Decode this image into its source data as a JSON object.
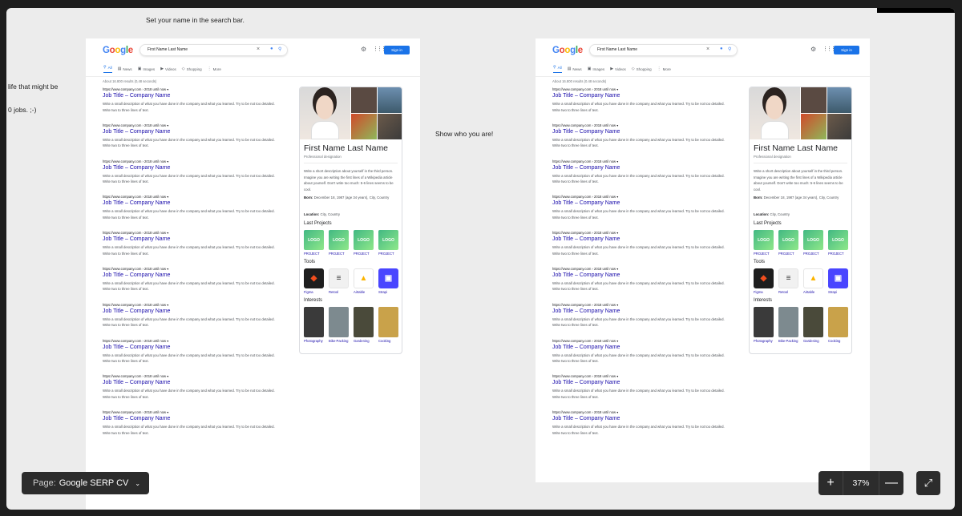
{
  "canvas": {
    "notes": {
      "top": "Set your name in the search bar.",
      "left_1": "life that might be",
      "left_2": "0 jobs. ;-)",
      "middle": "Show who you are!"
    }
  },
  "serp": {
    "logo_letters": [
      "G",
      "o",
      "o",
      "g",
      "l",
      "e"
    ],
    "search_query": "First Name Last Name",
    "signin_label": "Sign in",
    "tabs": [
      {
        "label": "All",
        "icon": "search-icon"
      },
      {
        "label": "News",
        "icon": "news-icon"
      },
      {
        "label": "Images",
        "icon": "image-icon"
      },
      {
        "label": "Videos",
        "icon": "video-icon"
      },
      {
        "label": "Shopping",
        "icon": "tag-icon"
      },
      {
        "label": "More",
        "icon": "more-icon"
      }
    ],
    "stats_left": "About 16.800 results (0,48 seconds)",
    "stats_right": "About 16.800 results (0.48 seconds)",
    "result_url": "https://www.company.com › 2018 until now ▾",
    "result_title": "Job Title – Company Name",
    "result_desc": "Write a small description of what you have done in the company and what you learned. Try to be not too detailed. Write two to three lines of text.",
    "result_count": 10
  },
  "panel": {
    "name": "First Name Last Name",
    "subtitle": "Professional designation",
    "description": "Write a short description about yourself in the third person. Imagine you are writing the first lines of a Wikipedia article about yourself. Don't write too much: 5-6 lines seems to be cool.",
    "born_label": "Born:",
    "born_value": "December 18, 1987 (age 34 years), City, Country",
    "location_label": "Location:",
    "location_value": "City, Country",
    "projects_title": "Last Projects",
    "projects": [
      {
        "logo": "LOGO",
        "caption": "PROJECT"
      },
      {
        "logo": "LOGO",
        "caption": "PROJECT"
      },
      {
        "logo": "LOGO",
        "caption": "PROJECT"
      },
      {
        "logo": "LOGO",
        "caption": "PROJECT"
      }
    ],
    "tools_title": "Tools",
    "tools": [
      {
        "name": "Figma",
        "bg": "#1e1e1e"
      },
      {
        "name": "Retool",
        "bg": "#f1f1f1"
      },
      {
        "name": "Airtable",
        "bg": "#ffffff"
      },
      {
        "name": "Strapi",
        "bg": "#4945ff"
      }
    ],
    "interests_title": "Interests",
    "interests": [
      {
        "name": "Photography",
        "color": "#3a3a3a"
      },
      {
        "name": "Bike-Packing",
        "color": "#7d8a8f"
      },
      {
        "name": "Gardening",
        "color": "#4a4a3a"
      },
      {
        "name": "Cooking",
        "color": "#c9a24a"
      }
    ]
  },
  "controls": {
    "page_label": "Page:",
    "page_name": "Google SERP CV",
    "zoom_value": "37%"
  }
}
